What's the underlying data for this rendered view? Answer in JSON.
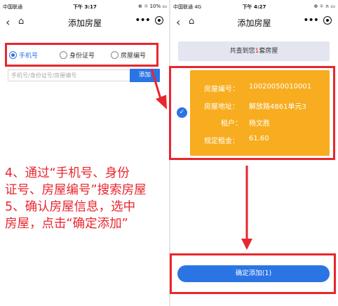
{
  "left": {
    "status": {
      "carrier": "中国联通 ",
      "time": "下午 3:17",
      "battery": "10%"
    },
    "nav": {
      "title": "添加房屋",
      "more": "•••"
    },
    "search_types": [
      {
        "label": "手机号",
        "selected": true
      },
      {
        "label": "身份证号",
        "selected": false
      },
      {
        "label": "房屋编号",
        "selected": false
      }
    ],
    "search": {
      "placeholder": "手机号/身份证号/房屋编号",
      "add_label": "添加"
    },
    "instructions": [
      "4、通过“手机号、身份",
      "证号、房屋编号”搜索房屋",
      "5、确认房屋信息，选中",
      "房屋，点击“确定添加”"
    ]
  },
  "right": {
    "status": {
      "carrier": "中国联通 4G",
      "time": "下午 4:27"
    },
    "nav": {
      "title": "添加房屋",
      "more": "•••"
    },
    "found": {
      "prefix": "共查到您",
      "count": "1",
      "suffix": "套房屋"
    },
    "card": {
      "rows": [
        {
          "label": "房屋编号：",
          "value": "10020050010001"
        },
        {
          "label": "房屋地址：",
          "value": "解放路4861单元3"
        },
        {
          "label": "租户：",
          "value": "杨文胜"
        },
        {
          "label": "规定租金：",
          "value": "61.60"
        }
      ]
    },
    "confirm_label": "确定添加(1)"
  },
  "colors": {
    "accent": "#2b74e4",
    "highlight": "#e8262e",
    "card": "#f7ad1f"
  }
}
